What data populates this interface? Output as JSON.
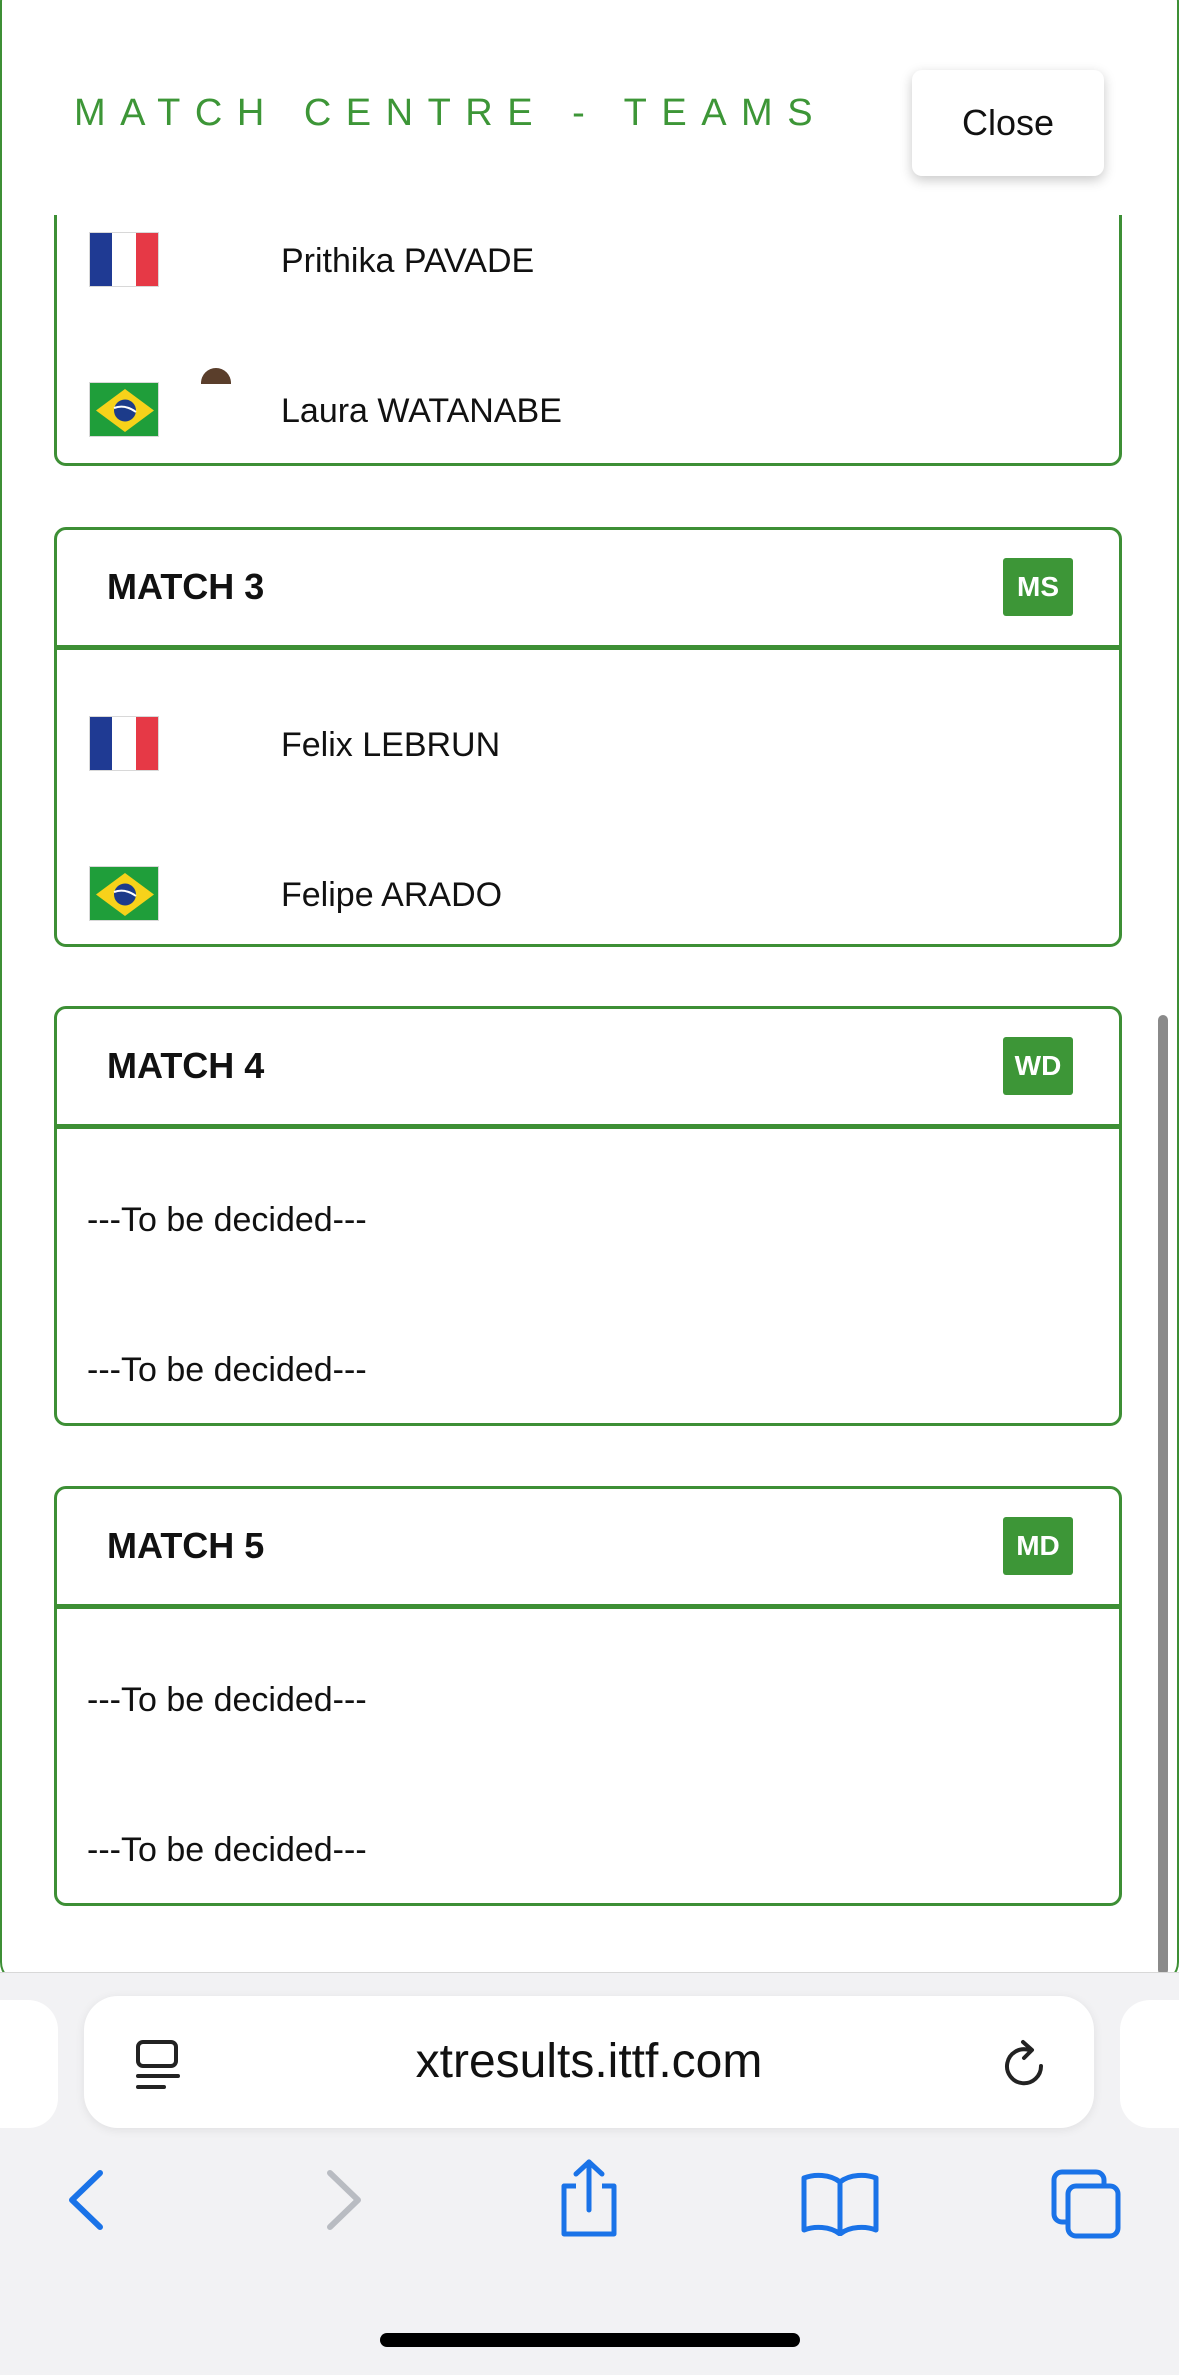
{
  "header": {
    "title": "MATCH CENTRE - TEAMS",
    "close_label": "Close"
  },
  "match2_partial": {
    "players": [
      {
        "name": "Prithika PAVADE",
        "flag": "france-flag"
      },
      {
        "name": "Laura WATANABE",
        "flag": "brazil-flag"
      }
    ]
  },
  "matches": [
    {
      "title": "MATCH 3",
      "badge": "MS",
      "players": [
        {
          "name": "Felix LEBRUN",
          "flag": "france-flag"
        },
        {
          "name": "Felipe ARADO",
          "flag": "brazil-flag"
        }
      ]
    },
    {
      "title": "MATCH 4",
      "badge": "WD",
      "tbd": [
        "---To be decided---",
        "---To be decided---"
      ]
    },
    {
      "title": "MATCH 5",
      "badge": "MD",
      "tbd": [
        "---To be decided---",
        "---To be decided---"
      ]
    }
  ],
  "browser": {
    "url": "xtresults.ittf.com"
  },
  "colors": {
    "accent": "#3d9637",
    "ios_blue": "#1a73e8"
  }
}
